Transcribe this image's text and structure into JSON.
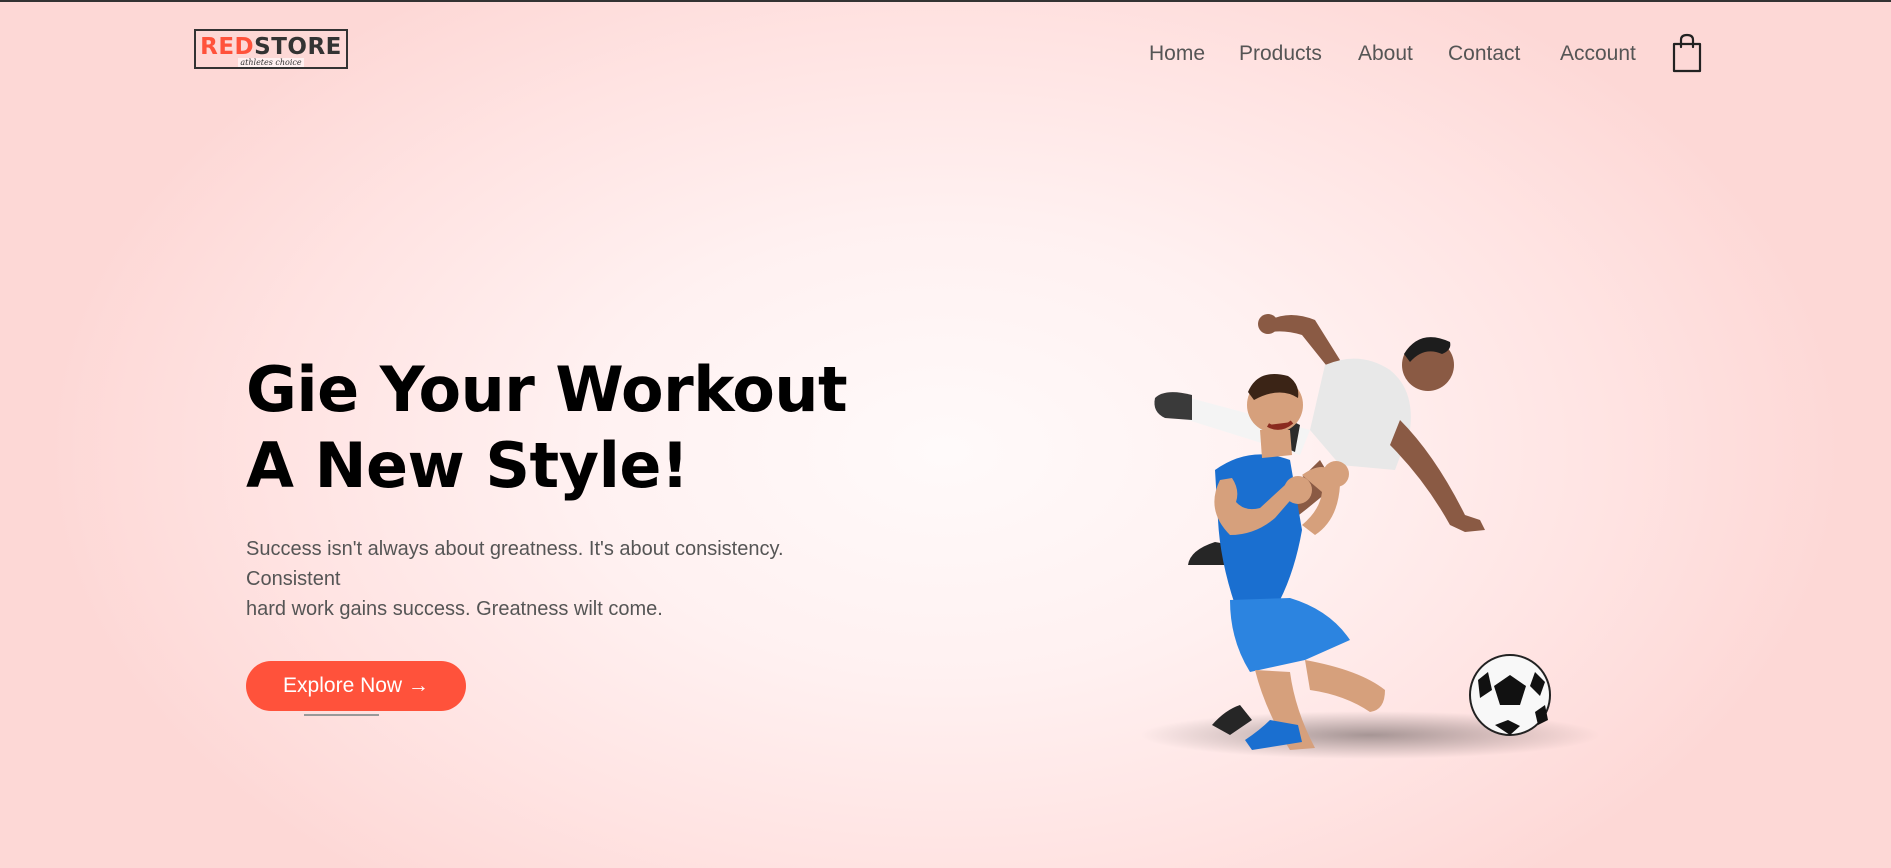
{
  "logo": {
    "brand_red": "RED",
    "brand_dark": "STORE",
    "tagline": "athletes choice"
  },
  "nav": {
    "items": [
      {
        "label": "Home"
      },
      {
        "label": "Products"
      },
      {
        "label": "About"
      },
      {
        "label": "Contact"
      },
      {
        "label": "Account"
      }
    ],
    "cart_icon": "shopping-bag-icon"
  },
  "hero": {
    "title_line1": "Gie Your Workout",
    "title_line2": "A New Style!",
    "text_line1": "Success isn't always about greatness. It's about consistency.",
    "text_line2": "Consistent",
    "text_line3": "hard work gains success. Greatness wilt come.",
    "button_label": "Explore Now →",
    "image_subject": "two soccer players celebrating with a soccer ball"
  },
  "colors": {
    "accent": "#ff523b",
    "text_dark": "#000000",
    "text_muted": "#555555",
    "background": "#ffe3e2"
  }
}
